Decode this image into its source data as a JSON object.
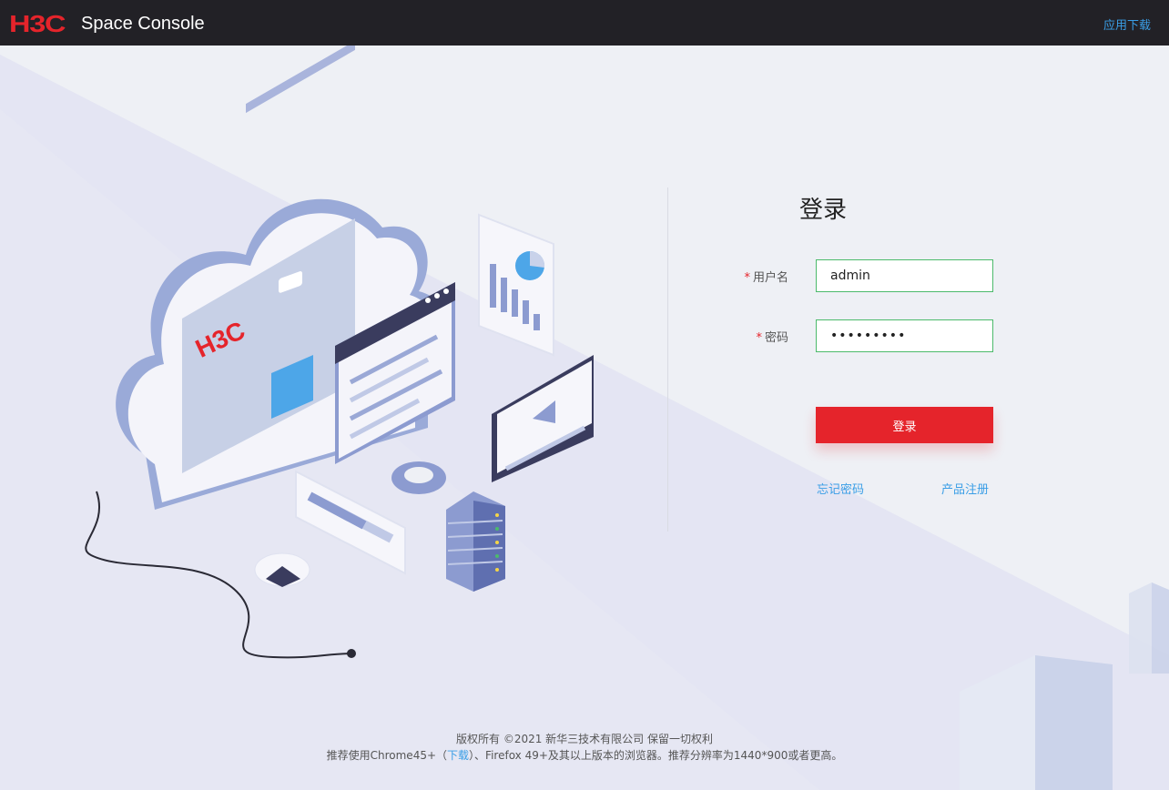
{
  "header": {
    "logo_mark": "H3C",
    "logo_text": "Space Console",
    "app_download": "应用下载"
  },
  "illustration": {
    "brand_text": "H3C"
  },
  "login": {
    "title": "登录",
    "required_mark": "*",
    "username_label": "用户名",
    "username_value": "admin",
    "password_label": "密码",
    "password_value": "•••••••••",
    "submit_label": "登录",
    "forgot_password": "忘记密码",
    "product_register": "产品注册"
  },
  "footer": {
    "copyright": "版权所有 ©2021 新华三技术有限公司 保留一切权利",
    "browser_prefix": "推荐使用Chrome45+（",
    "browser_link": "下载",
    "browser_suffix": "）、Firefox 49+及其以上版本的浏览器。推荐分辨率为1440*900或者更高。"
  },
  "colors": {
    "brand_red": "#e5242b",
    "link_blue": "#3a9ee6",
    "topbar": "#222126",
    "input_border": "#4cba6b"
  }
}
